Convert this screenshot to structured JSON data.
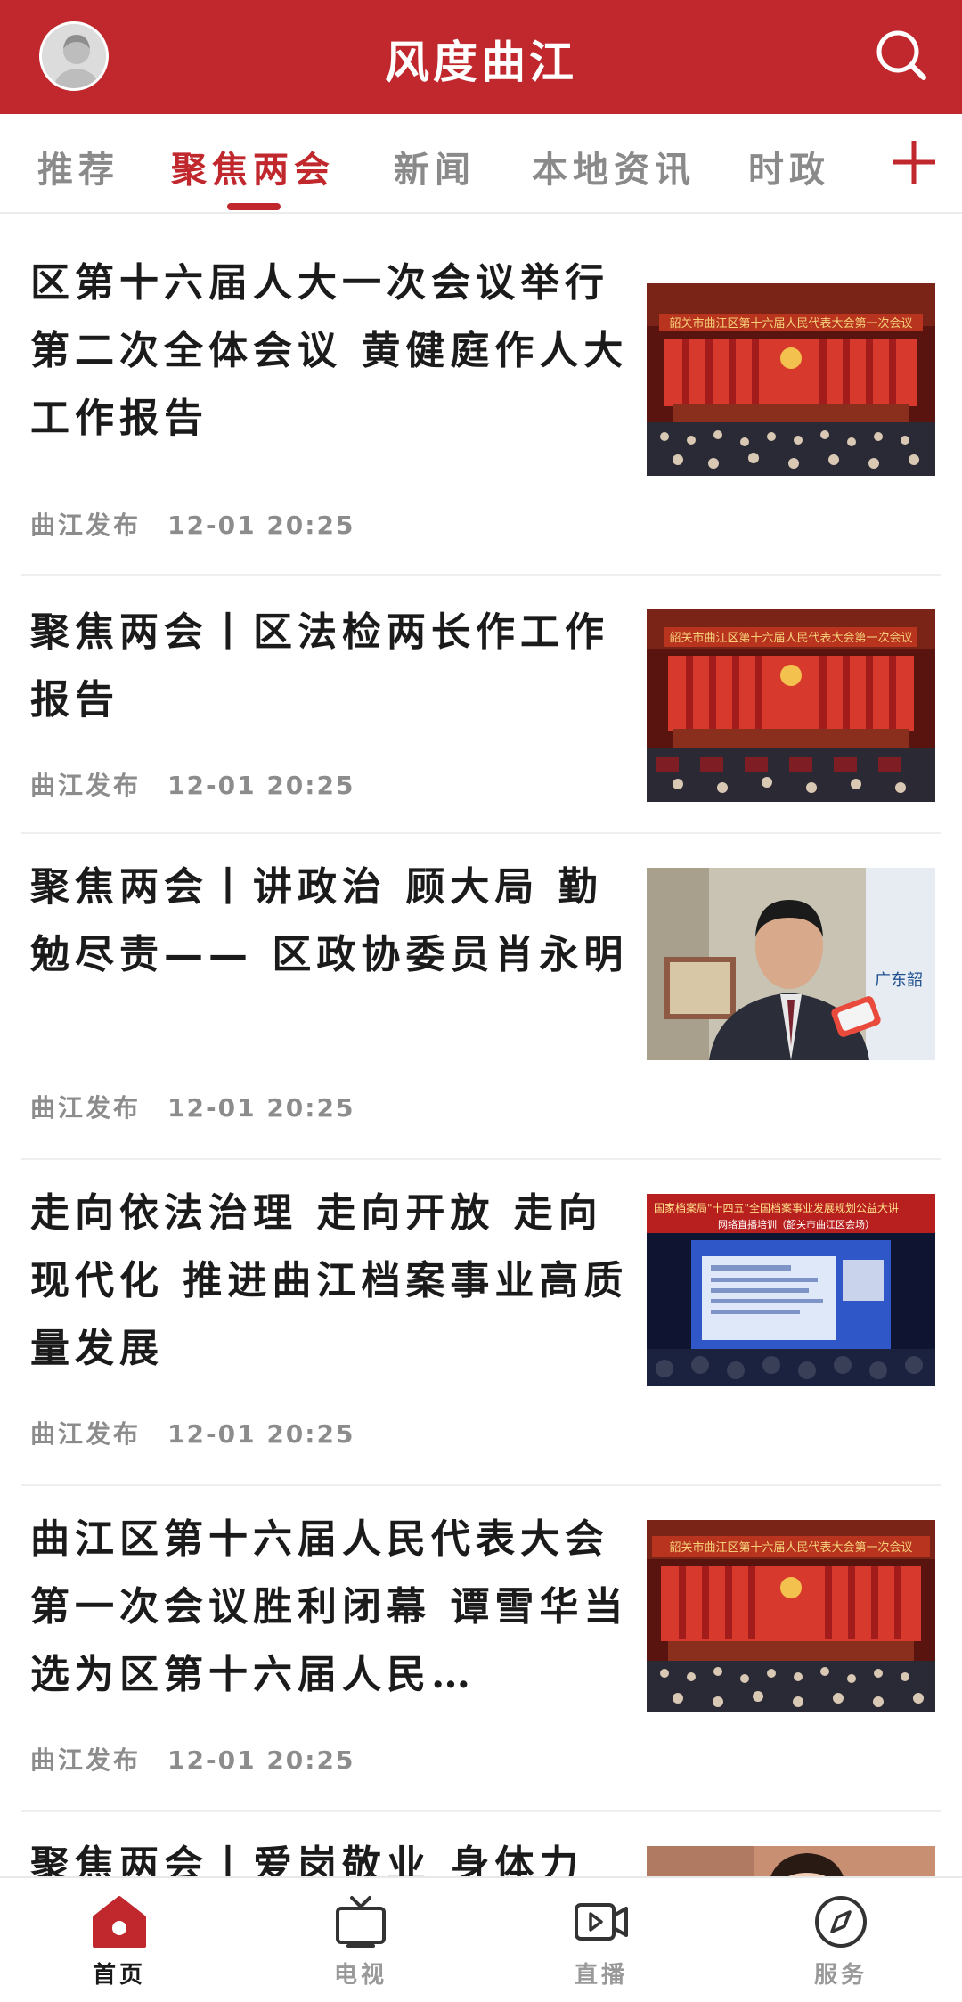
{
  "header": {
    "title": "风度曲江",
    "avatar_icon": "user-avatar-icon",
    "search_icon": "search-icon",
    "brand_color": "#c0282d"
  },
  "tabs": {
    "items": [
      {
        "label": "推荐"
      },
      {
        "label": "聚焦两会"
      },
      {
        "label": "新闻"
      },
      {
        "label": "本地资讯"
      },
      {
        "label": "时政"
      }
    ],
    "active": "聚焦两会",
    "add_icon": "plus-icon"
  },
  "articles": [
    {
      "title": "区第十六届人大一次会议举行第二次全体会议 黄健庭作人大工作报告",
      "source": "曲江发布",
      "time": "12-01 20:25",
      "thumbnail": "conference-hall-photo"
    },
    {
      "title": "聚焦两会丨区法检两长作工作报告",
      "source": "曲江发布",
      "time": "12-01 20:25",
      "thumbnail": "conference-hall-photo"
    },
    {
      "title": "聚焦两会丨讲政治 顾大局 勤勉尽责—— 区政协委员肖永明",
      "source": "曲江发布",
      "time": "12-01 20:25",
      "thumbnail": "interview-photo"
    },
    {
      "title": "走向依法治理 走向开放 走向现代化 推进曲江档案事业高质量发展",
      "source": "曲江发布",
      "time": "12-01 20:25",
      "thumbnail": "lecture-screen-photo"
    },
    {
      "title": "曲江区第十六届人民代表大会第一次会议胜利闭幕 谭雪华当选为区第十六届人民…",
      "source": "曲江发布",
      "time": "12-01 20:25",
      "thumbnail": "conference-hall-photo"
    },
    {
      "title": "聚焦两会丨爱岗敬业 身体力",
      "source": "",
      "time": "",
      "thumbnail": "portrait-photo"
    }
  ],
  "bottom_nav": {
    "items": [
      {
        "label": "首页",
        "icon": "home-icon"
      },
      {
        "label": "电视",
        "icon": "tv-icon"
      },
      {
        "label": "直播",
        "icon": "live-video-icon"
      },
      {
        "label": "服务",
        "icon": "compass-icon"
      }
    ],
    "active": "首页"
  }
}
